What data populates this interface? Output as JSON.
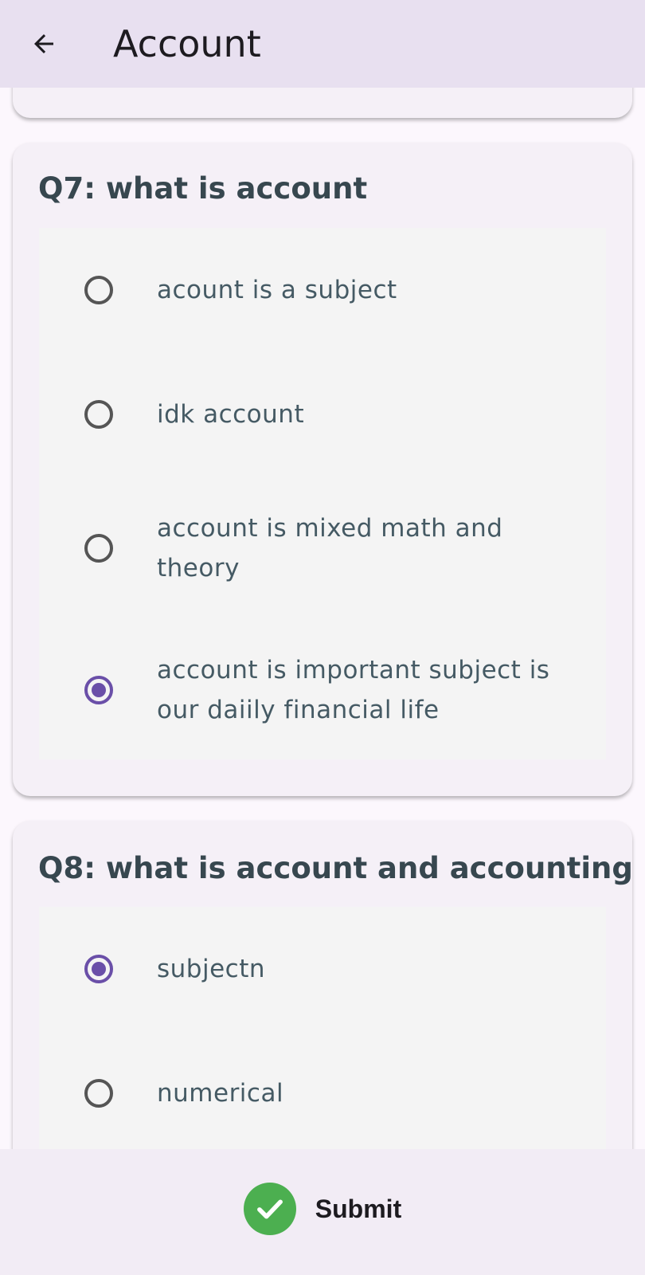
{
  "appbar": {
    "title": "Account"
  },
  "questions": [
    {
      "title": "Q7: what is account",
      "options": [
        {
          "label": "acount is a subject",
          "selected": false
        },
        {
          "label": "idk account",
          "selected": false
        },
        {
          "label": "account is mixed math and theory",
          "selected": false
        },
        {
          "label": "account is important subject is our daiily financial life",
          "selected": true
        }
      ]
    },
    {
      "title": "Q8: what is account and accounting",
      "options": [
        {
          "label": "subjectn",
          "selected": true
        },
        {
          "label": "numerical",
          "selected": false
        }
      ]
    }
  ],
  "footer": {
    "submit_label": "Submit"
  },
  "colors": {
    "accent": "#6a4fa8",
    "submit_icon": "#4caf50",
    "appbar": "#e8e0f0"
  }
}
